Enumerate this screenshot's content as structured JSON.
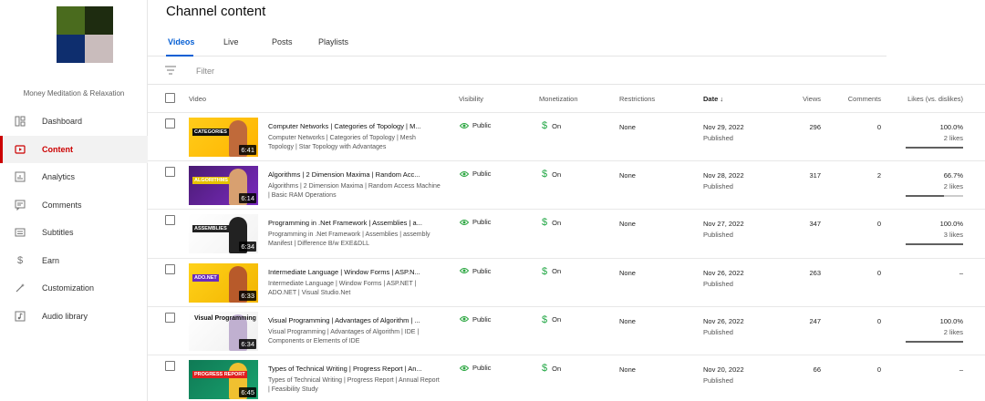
{
  "sidebar": {
    "channel_name": "Money Meditation & Relaxation",
    "logo_colors": [
      "#4a6b1e",
      "#1e2c10",
      "#0e2e6e",
      "#c9bcbc"
    ],
    "items": [
      {
        "label": "Dashboard",
        "icon": "dashboard-icon"
      },
      {
        "label": "Content",
        "icon": "content-icon",
        "active": true
      },
      {
        "label": "Analytics",
        "icon": "analytics-icon"
      },
      {
        "label": "Comments",
        "icon": "comments-icon"
      },
      {
        "label": "Subtitles",
        "icon": "subtitles-icon"
      },
      {
        "label": "Earn",
        "icon": "earn-icon"
      },
      {
        "label": "Customization",
        "icon": "customization-icon"
      },
      {
        "label": "Audio library",
        "icon": "audio-library-icon"
      }
    ]
  },
  "main": {
    "title": "Channel content",
    "tabs": [
      "Videos",
      "Live",
      "Posts",
      "Playlists"
    ],
    "active_tab": "Videos",
    "filter_placeholder": "Filter",
    "columns": {
      "video": "Video",
      "visibility": "Visibility",
      "monetization": "Monetization",
      "restrictions": "Restrictions",
      "date": "Date ↓",
      "views": "Views",
      "comments": "Comments",
      "likes": "Likes (vs. dislikes)"
    },
    "rows": [
      {
        "badge": "CATEGORIES",
        "duration": "6:41",
        "title": "Computer Networks | Categories of Topology | M...",
        "description": "Computer Networks | Categories of Topology | Mesh Topology | Star Topology with Advantages",
        "visibility": "Public",
        "monetization": "On",
        "restrictions": "None",
        "date": "Nov 29, 2022",
        "status": "Published",
        "views": "296",
        "comments": "0",
        "likes_pct": "100.0%",
        "likes_count": "2 likes",
        "like_ratio": 1.0
      },
      {
        "badge": "ALGORITHMS",
        "duration": "6:14",
        "title": "Algorithms | 2 Dimension Maxima | Random Acc...",
        "description": "Algorithms | 2 Dimension Maxima | Random Access Machine | Basic RAM Operations",
        "visibility": "Public",
        "monetization": "On",
        "restrictions": "None",
        "date": "Nov 28, 2022",
        "status": "Published",
        "views": "317",
        "comments": "2",
        "likes_pct": "66.7%",
        "likes_count": "2 likes",
        "like_ratio": 0.667
      },
      {
        "badge": "ASSEMBLIES",
        "duration": "6:34",
        "title": "Programming in .Net Framework | Assemblies | a...",
        "description": "Programming in .Net Framework | Assemblies | assembly Manifest | Difference B/w EXE&DLL",
        "visibility": "Public",
        "monetization": "On",
        "restrictions": "None",
        "date": "Nov 27, 2022",
        "status": "Published",
        "views": "347",
        "comments": "0",
        "likes_pct": "100.0%",
        "likes_count": "3 likes",
        "like_ratio": 1.0
      },
      {
        "badge": "ADO.NET",
        "duration": "6:33",
        "title": "Intermediate Language | Window Forms | ASP.N...",
        "description": "Intermediate Language | Window Forms | ASP.NET | ADO.NET | Visual Studio.Net",
        "visibility": "Public",
        "monetization": "On",
        "restrictions": "None",
        "date": "Nov 26, 2022",
        "status": "Published",
        "views": "263",
        "comments": "0",
        "likes_pct": "–",
        "likes_count": "",
        "like_ratio": null
      },
      {
        "badge": "Visual Programming",
        "duration": "6:34",
        "title": "Visual Programming | Advantages of Algorithm | ...",
        "description": "Visual Programming | Advantages of Algorithm | IDE | Components or Elements of IDE",
        "visibility": "Public",
        "monetization": "On",
        "restrictions": "None",
        "date": "Nov 26, 2022",
        "status": "Published",
        "views": "247",
        "comments": "0",
        "likes_pct": "100.0%",
        "likes_count": "2 likes",
        "like_ratio": 1.0
      },
      {
        "badge": "PROGRESS REPORT",
        "duration": "6:45",
        "title": "Types of Technical Writing | Progress Report | An...",
        "description": "Types of Technical Writing | Progress Report | Annual Report | Feasibility Study",
        "visibility": "Public",
        "monetization": "On",
        "restrictions": "None",
        "date": "Nov 20, 2022",
        "status": "Published",
        "views": "66",
        "comments": "0",
        "likes_pct": "–",
        "likes_count": "",
        "like_ratio": null
      }
    ]
  },
  "colors": {
    "accent_blue": "#065fd4",
    "active_red": "#cc0000",
    "money_green": "#22a745",
    "visibility_green": "#2ba640"
  }
}
